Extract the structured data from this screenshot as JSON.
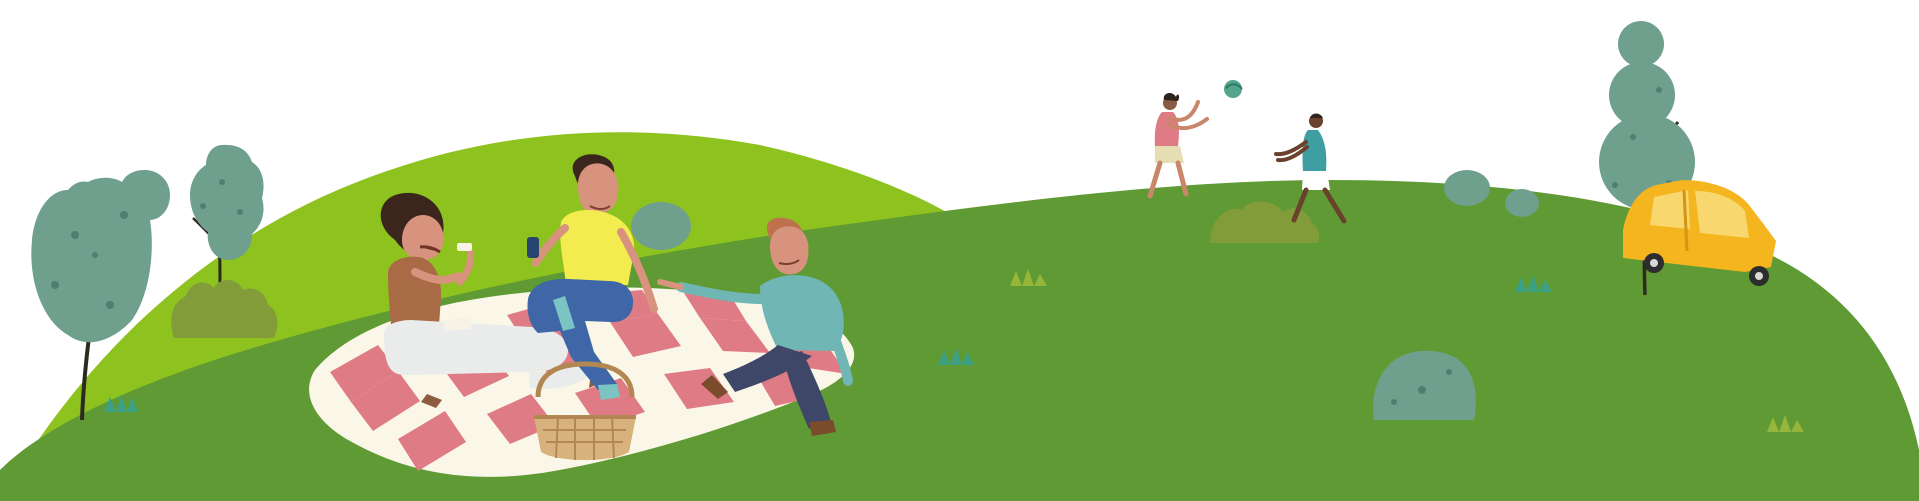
{
  "scene": {
    "palette": {
      "sky": "#ffffff",
      "light_hill": "#8ec21f",
      "main_hill": "#5f9a34",
      "tree_teal": "#6f9f8d",
      "tree_teal_dark": "#4f7f70",
      "blanket_pink": "#df7b84",
      "blanket_cream": "#fbf7e8",
      "van_yellow": "#f4b51f",
      "basket_tan": "#d8b27c",
      "ball": "#54a58d"
    },
    "elements": [
      "picnic-blanket",
      "woman-eating",
      "man-yellow-shirt",
      "man-teal-shirt",
      "basket",
      "girl-playing-ball",
      "boy-playing-ball",
      "yellow-van",
      "trees",
      "bushes",
      "grass-tufts"
    ]
  }
}
